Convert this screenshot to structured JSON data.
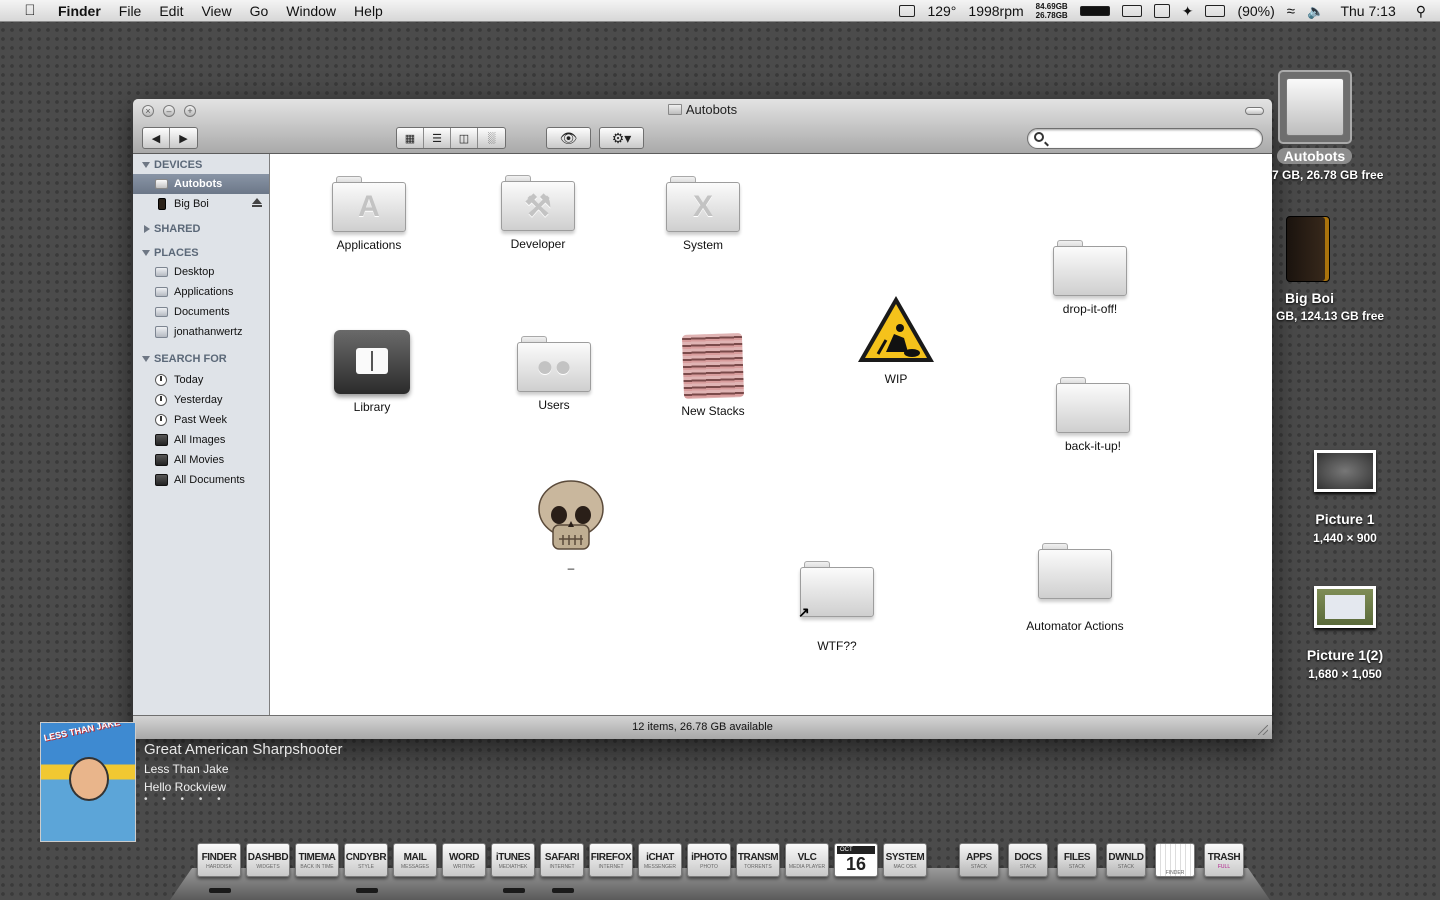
{
  "menubar": {
    "app_name": "Finder",
    "menus": [
      "File",
      "Edit",
      "View",
      "Go",
      "Window",
      "Help"
    ],
    "temp": "129°",
    "fan": "1998rpm",
    "disk_used": "84.69GB",
    "disk_free": "26.78GB",
    "battery": "(90%)",
    "clock": "Thu 7:13"
  },
  "window": {
    "title": "Autobots",
    "search_placeholder": "",
    "status": "12 items, 26.78 GB available"
  },
  "sidebar": {
    "sections": {
      "devices": "DEVICES",
      "shared": "SHARED",
      "places": "PLACES",
      "search_for": "SEARCH FOR"
    },
    "devices": [
      {
        "label": "Autobots",
        "icon": "drive-icon"
      },
      {
        "label": "Big Boi",
        "icon": "external-drive-icon"
      }
    ],
    "places": [
      {
        "label": "Desktop",
        "icon": "desktop-folder-icon"
      },
      {
        "label": "Applications",
        "icon": "applications-folder-icon"
      },
      {
        "label": "Documents",
        "icon": "documents-folder-icon"
      },
      {
        "label": "jonathanwertz",
        "icon": "home-icon"
      }
    ],
    "search_for": [
      {
        "label": "Today",
        "icon": "clock-icon"
      },
      {
        "label": "Yesterday",
        "icon": "clock-icon"
      },
      {
        "label": "Past Week",
        "icon": "clock-icon"
      },
      {
        "label": "All Images",
        "icon": "smart-folder-icon"
      },
      {
        "label": "All Movies",
        "icon": "smart-folder-icon"
      },
      {
        "label": "All Documents",
        "icon": "smart-folder-icon"
      }
    ]
  },
  "items": {
    "applications": "Applications",
    "developer": "Developer",
    "system": "System",
    "drop_it_off": "drop-it-off!",
    "library": "Library",
    "users": "Users",
    "new_stacks": "New Stacks",
    "wip": "WIP",
    "back_it_up": "back-it-up!",
    "dash": "–",
    "wtf": "WTF??",
    "automator": "Automator Actions"
  },
  "desktop": {
    "autobots_name": "Autobots",
    "autobots_info": "7 GB, 26.78 GB free",
    "bigboi_name": "Big Boi",
    "bigboi_info": "GB, 124.13 GB free",
    "picture1_name": "Picture 1",
    "picture1_info": "1,440 × 900",
    "picture2_name": "Picture 1(2)",
    "picture2_info": "1,680 × 1,050"
  },
  "now_playing": {
    "song": "Great American Sharpshooter",
    "artist": "Less Than Jake",
    "album": "Hello Rockview",
    "album_art_text": "LESS THAN JAKE",
    "rating": "• • • • •"
  },
  "dock": {
    "finder": {
      "title": "FINDER",
      "sub": "HARDDISK"
    },
    "dashbd": {
      "title": "DASHBD",
      "sub": "WIDGETS"
    },
    "timema": {
      "title": "TIMEMA",
      "sub": "BACK IN TIME"
    },
    "cndybr": {
      "title": "CNDYBR",
      "sub": "STYLE"
    },
    "mail": {
      "title": "MAIL",
      "sub": "MESSAGES"
    },
    "word": {
      "title": "WORD",
      "sub": "WRITING"
    },
    "itunes": {
      "title": "iTUNES",
      "sub": "MEDIATHEK"
    },
    "safari": {
      "title": "SAFARI",
      "sub": "INTERNET"
    },
    "firefox": {
      "title": "FIREFOX",
      "sub": "INTERNET"
    },
    "ichat": {
      "title": "iCHAT",
      "sub": "MESSENGER"
    },
    "iphoto": {
      "title": "iPHOTO",
      "sub": "PHOTO"
    },
    "transm": {
      "title": "TRANSM",
      "sub": "TORRENTS"
    },
    "vlc": {
      "title": "VLC",
      "sub": "MEDIA PLAYER"
    },
    "cal_month": "OCT",
    "cal_day": "16",
    "system": {
      "title": "SYSTEM",
      "sub": "MAC OSX"
    },
    "apps": {
      "title": "APPS",
      "sub": "STACK"
    },
    "docs": {
      "title": "DOCS",
      "sub": "STACK"
    },
    "files": {
      "title": "FILES",
      "sub": "STACK"
    },
    "dwnld": {
      "title": "DWNLD",
      "sub": "STACK"
    },
    "finder2": {
      "sub": "FINDER"
    },
    "trash": {
      "title": "TRASH",
      "sub": "FULL"
    }
  }
}
